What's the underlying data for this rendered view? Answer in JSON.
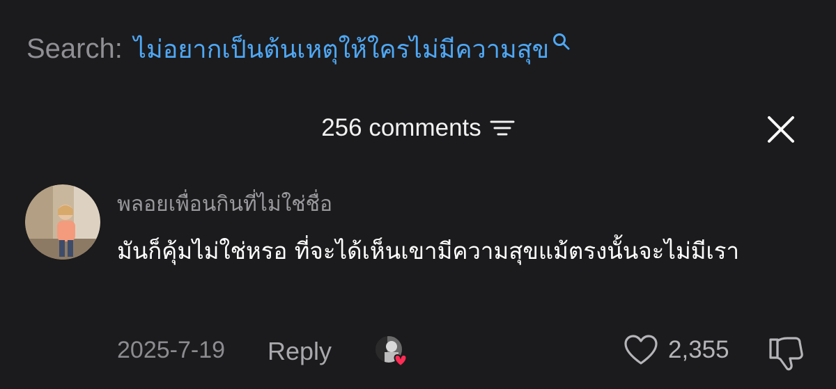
{
  "search": {
    "label": "Search:",
    "query": "ไม่อยากเป็นต้นเหตุให้ใครไม่มีความสุข",
    "icon": "search-icon"
  },
  "comments_panel": {
    "count_label": "256 comments",
    "sort_icon": "sort-lines-icon",
    "close_icon": "close-icon"
  },
  "comment": {
    "username": "พลอยเพื่อนกินที่ไม่ใช่ชื่อ",
    "text": "มันก็คุ้มไม่ใช่หรอ ที่จะได้เห็นเขามีความสุขแม้ตรงนั้นจะไม่มีเรา",
    "date": "2025-7-19",
    "reply_label": "Reply",
    "like_count": "2,355",
    "liked_by_creator": true,
    "colors": {
      "accent_heart": "#fe2c55",
      "search_query": "#4fa8f5"
    }
  }
}
